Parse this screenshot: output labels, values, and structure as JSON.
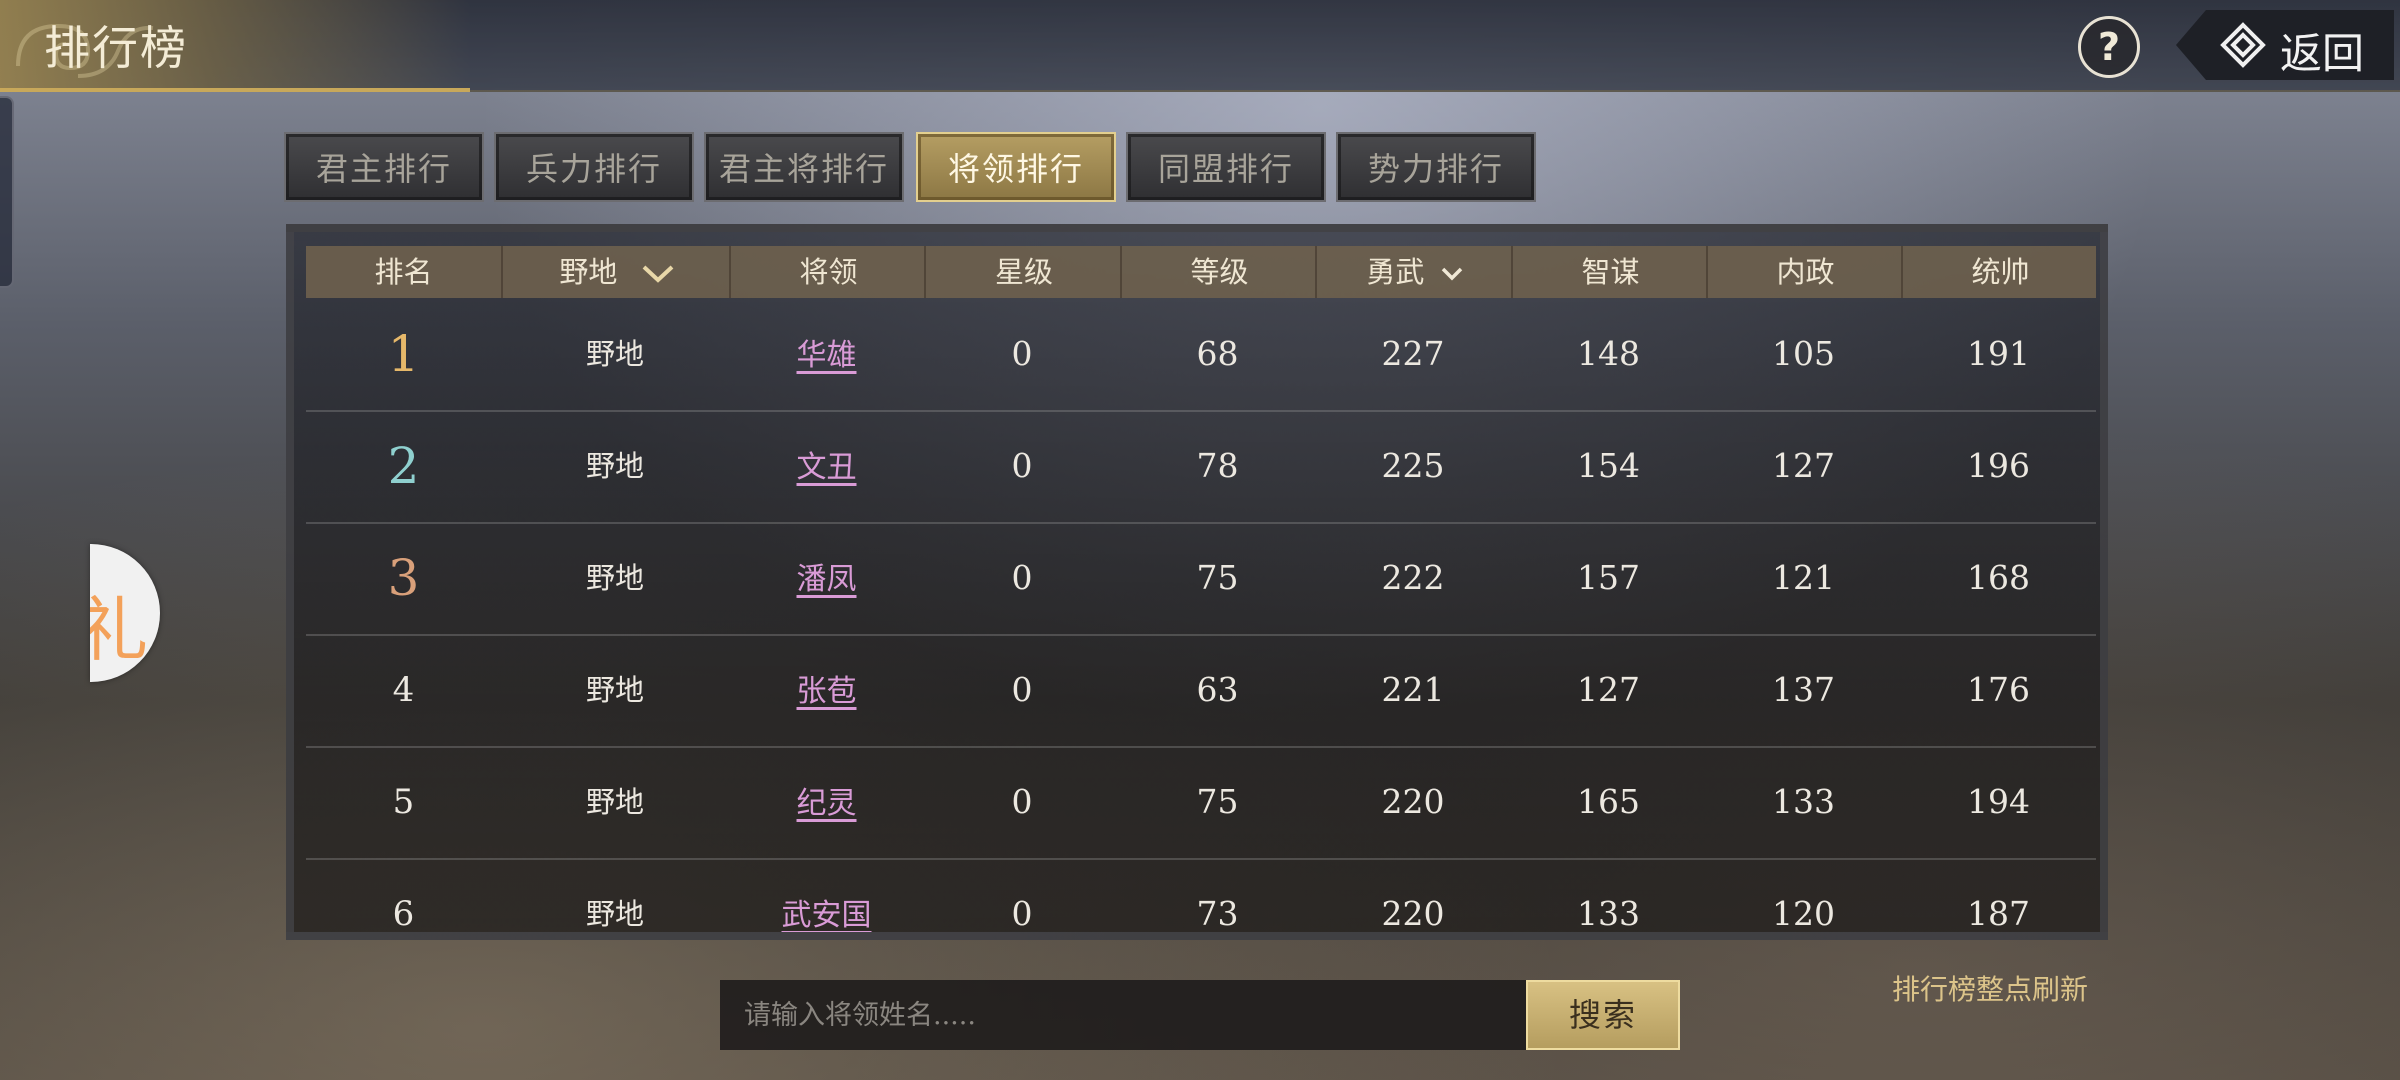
{
  "header": {
    "title": "排行榜",
    "help_label": "?",
    "back_label": "返回"
  },
  "side_bubble": {
    "text": "礼"
  },
  "tabs": [
    {
      "label": "君主排行",
      "active": false
    },
    {
      "label": "兵力排行",
      "active": false
    },
    {
      "label": "君主将排行",
      "active": false
    },
    {
      "label": "将领排行",
      "active": true
    },
    {
      "label": "同盟排行",
      "active": false
    },
    {
      "label": "势力排行",
      "active": false
    }
  ],
  "table": {
    "headers": {
      "rank": "排名",
      "region": "野地",
      "general": "将领",
      "star": "星级",
      "level": "等级",
      "valor": "勇武",
      "wisdom": "智谋",
      "politics": "内政",
      "command": "统帅"
    },
    "rows": [
      {
        "rank": "1",
        "region": "野地",
        "general": "华雄",
        "star": "0",
        "level": "68",
        "valor": "227",
        "wisdom": "148",
        "politics": "105",
        "command": "191"
      },
      {
        "rank": "2",
        "region": "野地",
        "general": "文丑",
        "star": "0",
        "level": "78",
        "valor": "225",
        "wisdom": "154",
        "politics": "127",
        "command": "196"
      },
      {
        "rank": "3",
        "region": "野地",
        "general": "潘凤",
        "star": "0",
        "level": "75",
        "valor": "222",
        "wisdom": "157",
        "politics": "121",
        "command": "168"
      },
      {
        "rank": "4",
        "region": "野地",
        "general": "张苞",
        "star": "0",
        "level": "63",
        "valor": "221",
        "wisdom": "127",
        "politics": "137",
        "command": "176"
      },
      {
        "rank": "5",
        "region": "野地",
        "general": "纪灵",
        "star": "0",
        "level": "75",
        "valor": "220",
        "wisdom": "165",
        "politics": "133",
        "command": "194"
      },
      {
        "rank": "6",
        "region": "野地",
        "general": "武安国",
        "star": "0",
        "level": "73",
        "valor": "220",
        "wisdom": "133",
        "politics": "120",
        "command": "187"
      }
    ]
  },
  "search": {
    "placeholder": "请输入将领姓名.....",
    "button_label": "搜索"
  },
  "refresh_note": "排行榜整点刷新"
}
